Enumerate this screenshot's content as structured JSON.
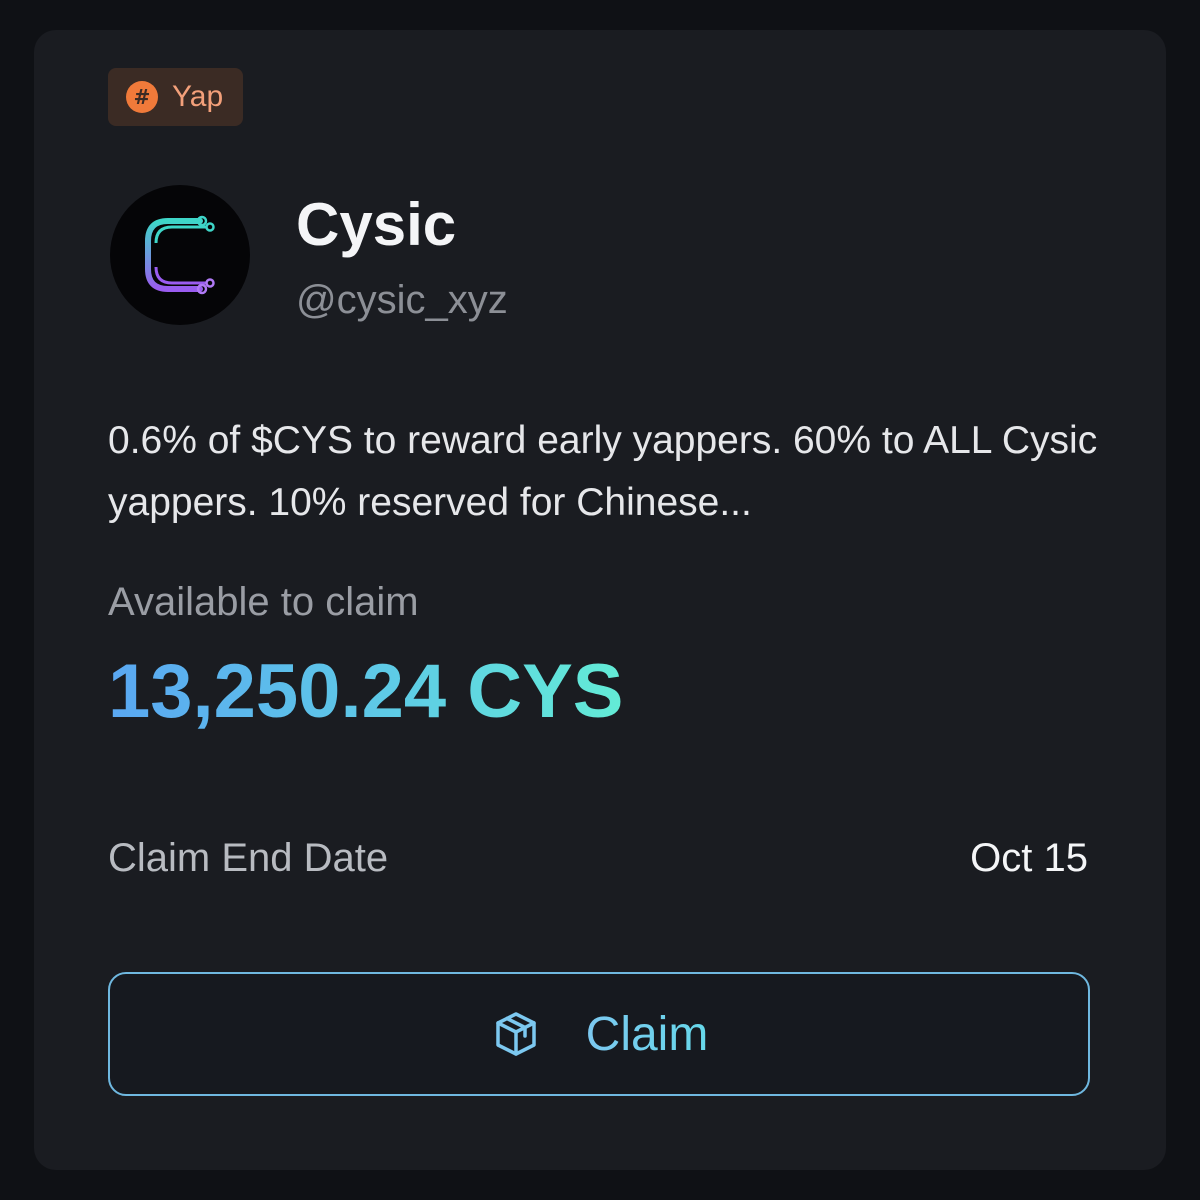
{
  "tag": {
    "label": "Yap",
    "icon": "hash-icon",
    "color": "#f07a3a"
  },
  "project": {
    "name": "Cysic",
    "handle": "@cysic_xyz",
    "avatar_icon": "cysic-logo-icon"
  },
  "description": "0.6% of $CYS to reward early yappers. 60% to ALL Cysic yappers. 10% reserved for Chinese...",
  "claim": {
    "available_label": "Available to claim",
    "amount": "13,250.24 CYS",
    "end_date_label": "Claim End Date",
    "end_date_value": "Oct 15",
    "button_label": "Claim",
    "button_icon": "package-icon"
  },
  "colors": {
    "card_bg": "#1a1c21",
    "accent_gradient_start": "#5aa7f2",
    "accent_gradient_end": "#63ecd6",
    "button_border": "#6fb8e0"
  }
}
